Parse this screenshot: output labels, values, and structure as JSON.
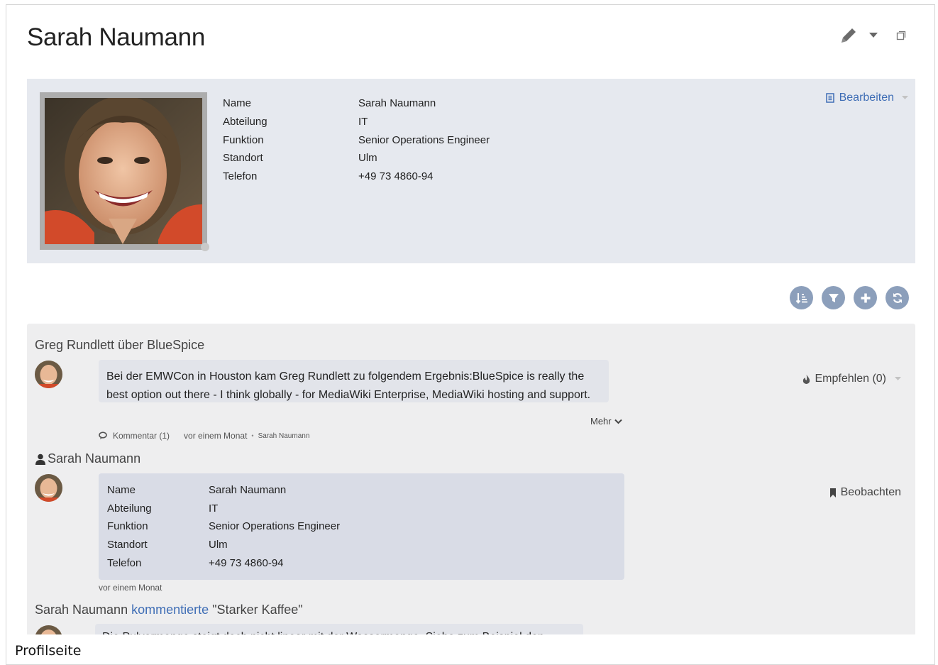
{
  "page": {
    "title": "Sarah Naumann",
    "caption": "Profilseite"
  },
  "profile": {
    "fields": [
      {
        "label": "Name",
        "value": "Sarah Naumann"
      },
      {
        "label": "Abteilung",
        "value": "IT"
      },
      {
        "label": "Funktion",
        "value": "Senior Operations Engineer"
      },
      {
        "label": "Standort",
        "value": "Ulm"
      },
      {
        "label": "Telefon",
        "value": "+49 73 4860-94"
      }
    ],
    "edit_label": "Bearbeiten"
  },
  "colors": {
    "link": "#3e6db5",
    "profile_bg": "#e6e9ef",
    "stream_bg": "#eeeeef",
    "tool_circle": "#8c9fbb"
  },
  "stream": {
    "entry1": {
      "title": "Greg Rundlett über BlueSpice",
      "text_line1": "Bei der EMWCon in Houston kam Greg Rundlett zu folgendem Ergebnis:BlueSpice is really the",
      "text_line2": "best option out there - I think globally - for MediaWiki Enterprise, MediaWiki hosting and support.",
      "more_label": "Mehr",
      "comment_label": "Kommentar (1)",
      "time": "vor einem Monat",
      "author": "Sarah Naumann",
      "action_label": "Empfehlen (0)"
    },
    "entry2": {
      "title": "Sarah Naumann",
      "time": "vor einem Monat",
      "action_label": "Beobachten"
    },
    "entry3": {
      "title_user": "Sarah Naumann",
      "title_link": "kommentierte",
      "title_page": "\"Starker Kaffee\"",
      "text": "Die Pulvermenge steigt doch nicht linear mit der Wassermenge. Siehe zum Beispiel den"
    }
  }
}
